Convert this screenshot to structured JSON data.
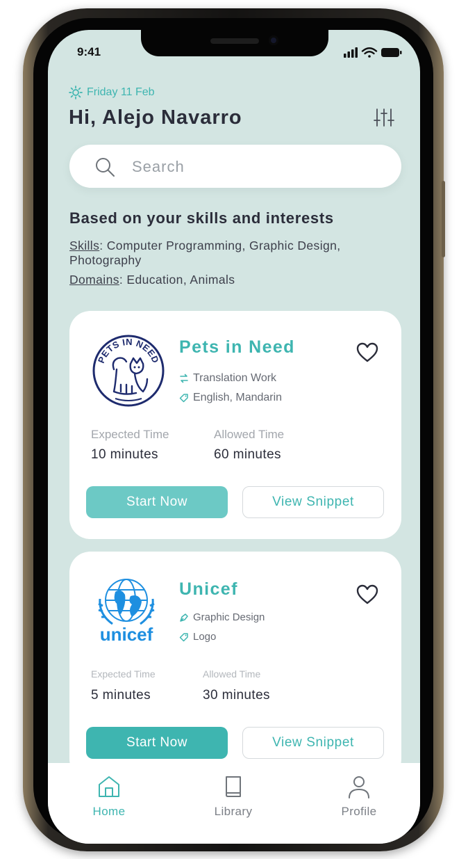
{
  "theme": {
    "accent": "#3eb5b0",
    "accent_light": "#6cc9c5",
    "screen_bg": "#d3e5e2",
    "text_dark": "#2b2d3a"
  },
  "status_bar": {
    "time": "9:41",
    "icons": [
      "signal-icon",
      "wifi-icon",
      "battery-icon"
    ]
  },
  "header": {
    "date": "Friday 11 Feb",
    "date_icon": "sun-icon",
    "greeting": "Hi, Alejo Navarro",
    "filter_icon": "sliders-icon"
  },
  "search": {
    "placeholder": "Search",
    "icon": "search-icon"
  },
  "recommendations": {
    "title": "Based on your skills and interests",
    "skills_label": "Skills",
    "skills_value": ": Computer Programming, Graphic Design, Photography",
    "domains_label": "Domains",
    "domains_value": ": Education, Animals"
  },
  "cards": [
    {
      "name": "Pets in Need",
      "logo_text": "PETS IN NEED",
      "logo_icon": "pets-in-need-logo",
      "category": "Translation Work",
      "category_icon": "swap-icon",
      "tags": "English, Mandarin",
      "tag_icon": "tag-icon",
      "expected_label": "Expected Time",
      "expected_value": "10 minutes",
      "allowed_label": "Allowed Time",
      "allowed_value": "60 minutes",
      "start_label": "Start Now",
      "snippet_label": "View Snippet",
      "start_color": "#6cc9c5"
    },
    {
      "name": "Unicef",
      "logo_text": "unicef",
      "logo_icon": "unicef-logo",
      "category": "Graphic Design",
      "category_icon": "pen-nib-icon",
      "tags": "Logo",
      "tag_icon": "tag-icon",
      "expected_label": "Expected Time",
      "expected_value": "5 minutes",
      "allowed_label": "Allowed Time",
      "allowed_value": "30 minutes",
      "start_label": "Start Now",
      "snippet_label": "View Snippet",
      "start_color": "#3eb5b0"
    }
  ],
  "tabbar": {
    "items": [
      {
        "label": "Home",
        "icon": "home-icon",
        "active": true
      },
      {
        "label": "Library",
        "icon": "book-icon",
        "active": false
      },
      {
        "label": "Profile",
        "icon": "user-icon",
        "active": false
      }
    ]
  }
}
